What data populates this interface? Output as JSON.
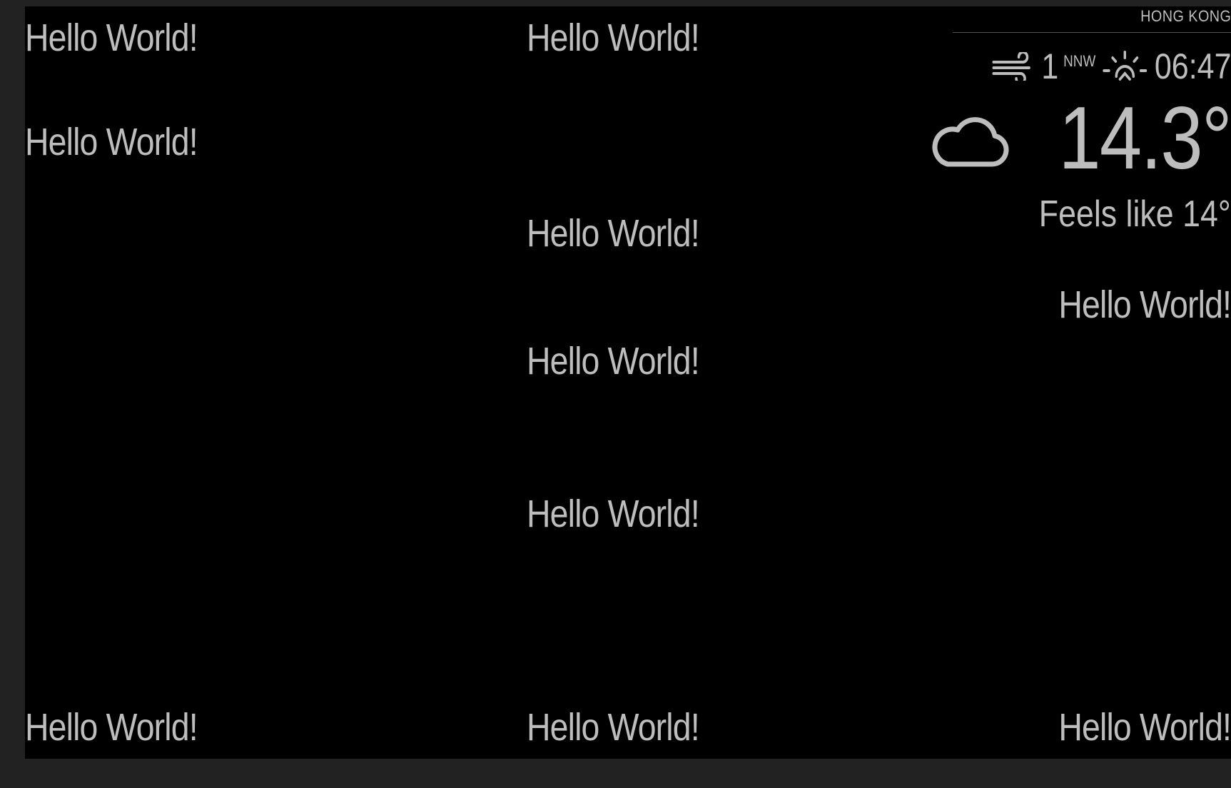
{
  "greetings": {
    "top_left": "Hello World!",
    "upper_left": "Hello World!",
    "top_center": "Hello World!",
    "upper_third_1": "Hello World!",
    "upper_third_2": "Hello World!",
    "middle_center": "Hello World!",
    "upper_right": "Hello World!",
    "bottom_left": "Hello World!",
    "bottom_center": "Hello World!",
    "bottom_right": "Hello World!"
  },
  "weather": {
    "location": "HONG KONG",
    "wind_speed": "1",
    "wind_direction": "NNW",
    "sun_time": "06:47",
    "temperature": "14.3°",
    "feels_like": "Feels like 14°",
    "icons": {
      "wind": "wind-icon",
      "sun": "sunrise-icon",
      "condition": "cloudy-icon"
    }
  },
  "colors": {
    "text": "#bdbdbd",
    "background": "#000000",
    "frame": "#222222"
  }
}
